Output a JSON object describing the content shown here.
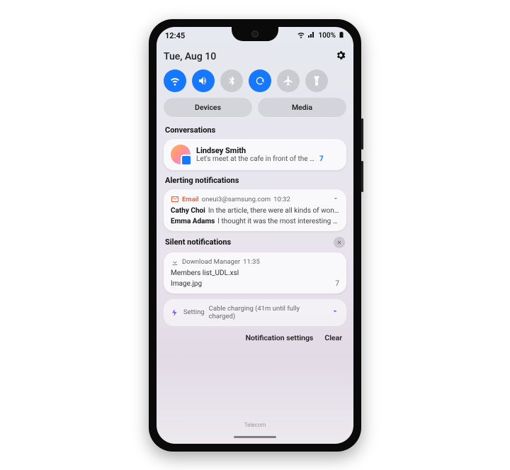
{
  "status": {
    "time": "12:45",
    "battery_text": "100%",
    "signal_icon": "signal-icon",
    "wifi_icon": "wifi-icon",
    "battery_icon": "battery-icon"
  },
  "shade": {
    "date": "Tue, Aug 10",
    "settings_icon": "gear-icon",
    "toggles": [
      {
        "name": "wifi-toggle",
        "icon": "wifi-icon",
        "on": true
      },
      {
        "name": "sound-toggle",
        "icon": "volume-icon",
        "on": true
      },
      {
        "name": "bluetooth-toggle",
        "icon": "bluetooth-icon",
        "on": false
      },
      {
        "name": "rotate-toggle",
        "icon": "rotate-icon",
        "on": true
      },
      {
        "name": "airplane-toggle",
        "icon": "airplane-icon",
        "on": false
      },
      {
        "name": "flashlight-toggle",
        "icon": "flashlight-icon",
        "on": false
      }
    ],
    "pills": {
      "devices": "Devices",
      "media": "Media"
    }
  },
  "conversations": {
    "header": "Conversations",
    "item": {
      "sender": "Lindsey Smith",
      "preview": "Let's meet at the cafe in front of the coff…",
      "count": "7"
    }
  },
  "alerting": {
    "header": "Alerting notifications",
    "app": "Email",
    "account": "oneui3@samsung.com",
    "time": "10:32",
    "lines": [
      {
        "who": "Cathy Choi",
        "txt": "In the article, there were all kinds of wond…"
      },
      {
        "who": "Emma Adams",
        "txt": "I thought it was the most interesting th…"
      }
    ]
  },
  "silent": {
    "header": "Silent notifications",
    "dl": {
      "app": "Download Manager",
      "time": "11:35",
      "file1": "Members list_UDL.xsl",
      "file2": "Image.jpg",
      "count": "7"
    },
    "setting": {
      "app": "Setting",
      "txt": "Cable charging (41m until fully charged)"
    }
  },
  "footer": {
    "settings": "Notification settings",
    "clear": "Clear"
  },
  "carrier": "Telecom"
}
